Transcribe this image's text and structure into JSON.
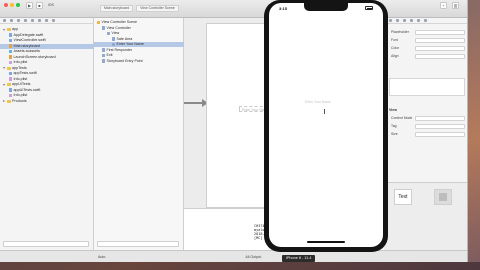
{
  "toolbar": {
    "scheme": "iOS",
    "jumpbar": [
      "Main.storyboard",
      "View Controller Scene"
    ]
  },
  "navigator": {
    "items": [
      {
        "label": "app",
        "kind": "folder",
        "depth": 0,
        "open": true
      },
      {
        "label": "AppDelegate.swift",
        "kind": "file",
        "depth": 1
      },
      {
        "label": "ViewController.swift",
        "kind": "file",
        "depth": 1
      },
      {
        "label": "Main.storyboard",
        "kind": "story",
        "depth": 1,
        "selected": true
      },
      {
        "label": "Assets.xcassets",
        "kind": "asset",
        "depth": 1
      },
      {
        "label": "LaunchScreen.storyboard",
        "kind": "story",
        "depth": 1
      },
      {
        "label": "Info.plist",
        "kind": "plist",
        "depth": 1
      },
      {
        "label": "appTests",
        "kind": "folder",
        "depth": 0,
        "open": true
      },
      {
        "label": "appTests.swift",
        "kind": "file",
        "depth": 1
      },
      {
        "label": "Info.plist",
        "kind": "plist",
        "depth": 1
      },
      {
        "label": "appUITests",
        "kind": "folder",
        "depth": 0,
        "open": true
      },
      {
        "label": "appUITests.swift",
        "kind": "file",
        "depth": 1
      },
      {
        "label": "Info.plist",
        "kind": "plist",
        "depth": 1
      },
      {
        "label": "Products",
        "kind": "folder",
        "depth": 0,
        "open": false
      }
    ]
  },
  "outline": {
    "items": [
      {
        "label": "View Controller Scene",
        "depth": 0
      },
      {
        "label": "View Controller",
        "depth": 1
      },
      {
        "label": "View",
        "depth": 2
      },
      {
        "label": "Safe Area",
        "depth": 3
      },
      {
        "label": "Enter Your Name",
        "depth": 3,
        "selected": true
      },
      {
        "label": "First Responder",
        "depth": 1
      },
      {
        "label": "Exit",
        "depth": 1
      },
      {
        "label": "Storyboard Entry Point",
        "depth": 1
      }
    ]
  },
  "canvas": {
    "placeholder": "Enter Your Name",
    "device_label": "View as: iPhone 8 (wC hR)"
  },
  "console": {
    "lines": [
      "CH3740EF7A",
      "myalongwith",
      "2018-06-2",
      "[MC] Readi"
    ]
  },
  "inspector": {
    "placeholder_label": "Placeholder",
    "font_label": "Font",
    "color_label": "Color",
    "align_label": "Align",
    "view_label": "View",
    "content_mode_label": "Content Mode",
    "tag_label": "Tag",
    "size_label": "Size",
    "library_text": "Text"
  },
  "status": {
    "left": "Auto",
    "right": "All Output"
  },
  "simulator": {
    "time": "3:15",
    "placeholder": "Enter Your Name",
    "device_label": "iPhone 8 - 11.4"
  },
  "colors": {
    "selection": "#b5c8e6",
    "folder": "#f3c44a",
    "simulator_frame": "#141414"
  }
}
